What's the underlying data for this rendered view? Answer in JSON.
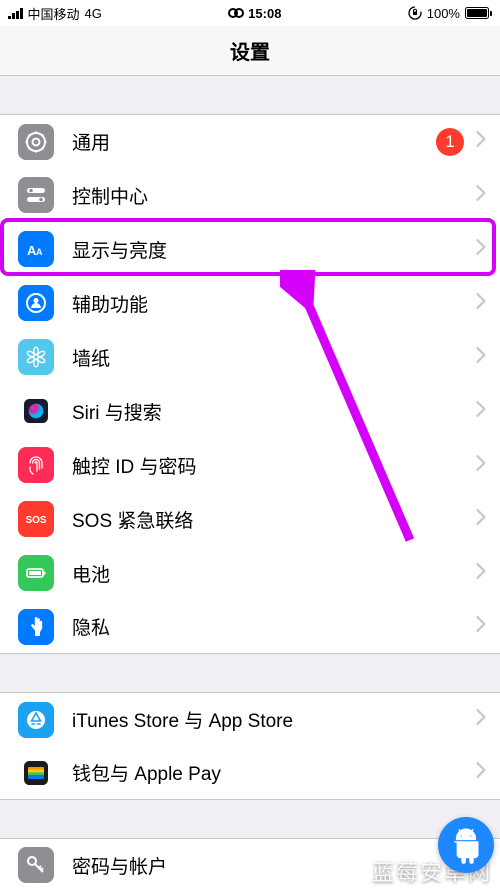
{
  "status": {
    "carrier": "中国移动",
    "network": "4G",
    "time": "15:08",
    "battery_pct": "100%"
  },
  "nav": {
    "title": "设置"
  },
  "rows": [
    {
      "key": "general",
      "label": "通用",
      "badge": "1",
      "icon": "gear",
      "color": "#8e8e93"
    },
    {
      "key": "control-center",
      "label": "控制中心",
      "icon": "switches",
      "color": "#8e8e93"
    },
    {
      "key": "display",
      "label": "显示与亮度",
      "icon": "aa",
      "color": "#007aff"
    },
    {
      "key": "accessibility",
      "label": "辅助功能",
      "icon": "person-circle",
      "color": "#007aff"
    },
    {
      "key": "wallpaper",
      "label": "墙纸",
      "icon": "flower",
      "color": "#54c7ec"
    },
    {
      "key": "siri",
      "label": "Siri 与搜索",
      "icon": "siri",
      "color": "siri"
    },
    {
      "key": "touchid",
      "label": "触控 ID 与密码",
      "icon": "fingerprint",
      "color": "#ff2d55"
    },
    {
      "key": "sos",
      "label": "SOS 紧急联络",
      "icon": "sos",
      "color": "#ff3b30"
    },
    {
      "key": "battery",
      "label": "电池",
      "icon": "battery",
      "color": "#34c759"
    },
    {
      "key": "privacy",
      "label": "隐私",
      "icon": "hand",
      "color": "#007aff"
    }
  ],
  "group2": [
    {
      "key": "itunes",
      "label": "iTunes Store 与 App Store",
      "icon": "appstore",
      "color": "#1da1f2"
    },
    {
      "key": "wallet",
      "label": "钱包与 Apple Pay",
      "icon": "wallet",
      "color": "#000"
    }
  ],
  "group3": [
    {
      "key": "passwords",
      "label": "密码与帐户",
      "icon": "key",
      "color": "#8e8e93"
    }
  ],
  "watermark": "蓝莓安卓网",
  "annotations": {
    "highlight_row": "display",
    "arrow_color": "#d500f9"
  }
}
